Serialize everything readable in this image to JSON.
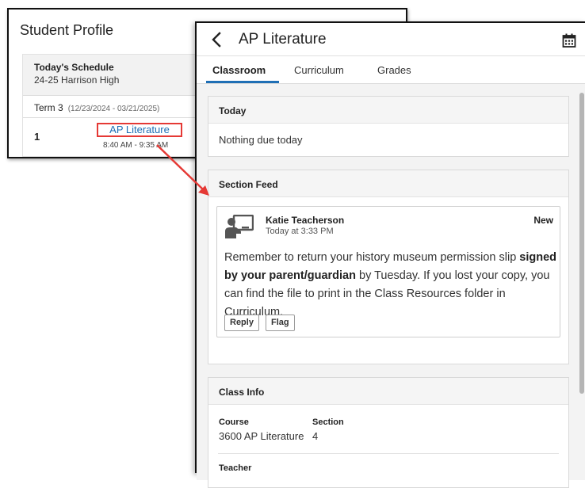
{
  "student_profile": {
    "title": "Student Profile",
    "schedule": {
      "heading": "Today's Schedule",
      "school": "24-25 Harrison High",
      "term_label": "Term 3",
      "term_dates": "(12/23/2024 - 03/21/2025)",
      "period": "1",
      "course_link": "AP Literature",
      "course_time": "8:40 AM - 9:35 AM"
    }
  },
  "course_window": {
    "title": "AP Literature",
    "icons": {
      "back": "chevron-left-icon",
      "calendar": "calendar-icon"
    },
    "tabs": [
      {
        "label": "Classroom",
        "active": true
      },
      {
        "label": "Curriculum",
        "active": false
      },
      {
        "label": "Grades",
        "active": false
      }
    ],
    "today": {
      "heading": "Today",
      "message": "Nothing due today"
    },
    "section_feed": {
      "heading": "Section Feed",
      "post": {
        "author": "Katie Teacherson",
        "time": "Today at 3:33 PM",
        "badge": "New",
        "text_1": "Remember to return your history museum permission slip ",
        "text_bold": "signed by your parent/guardian",
        "text_2": " by Tuesday. If you lost your copy, you can find the file to print in the Class Resources folder in Curriculum.",
        "reply_label": "Reply",
        "flag_label": "Flag",
        "avatar_icon": "teacher-avatar-icon"
      }
    },
    "class_info": {
      "heading": "Class Info",
      "course_label": "Course",
      "course_value": "3600 AP Literature",
      "section_label": "Section",
      "section_value": "4",
      "teacher_label": "Teacher"
    }
  },
  "colors": {
    "accent": "#1f6fb5",
    "highlight": "#e53935",
    "panel_bg": "#f3f3f3"
  }
}
